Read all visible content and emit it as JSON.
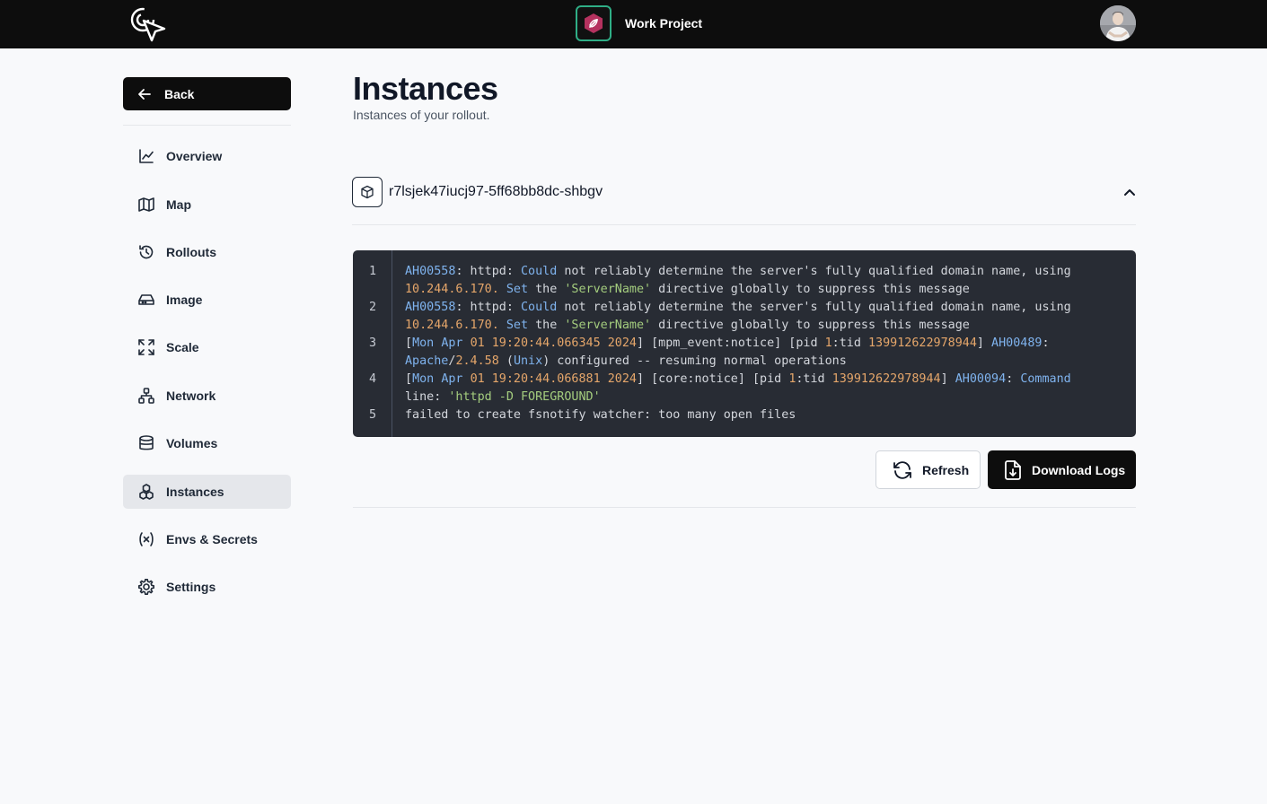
{
  "header": {
    "project_name": "Work Project"
  },
  "sidebar": {
    "back_label": "Back",
    "items": [
      {
        "label": "Overview",
        "icon": "chart-line-icon"
      },
      {
        "label": "Map",
        "icon": "map-icon"
      },
      {
        "label": "Rollouts",
        "icon": "history-icon"
      },
      {
        "label": "Image",
        "icon": "hard-drive-icon"
      },
      {
        "label": "Scale",
        "icon": "scale-expand-icon"
      },
      {
        "label": "Network",
        "icon": "network-icon"
      },
      {
        "label": "Volumes",
        "icon": "database-icon"
      },
      {
        "label": "Instances",
        "icon": "boxes-icon",
        "active": true
      },
      {
        "label": "Envs & Secrets",
        "icon": "variable-icon"
      },
      {
        "label": "Settings",
        "icon": "gear-icon"
      }
    ]
  },
  "main": {
    "title": "Instances",
    "subtitle": "Instances of your rollout.",
    "instance": {
      "name": "r7lsjek47iucj97-5ff68bb8dc-shbgv",
      "expanded": true
    },
    "logs": {
      "line_numbers": [
        "1",
        "2",
        "3",
        "4",
        "5"
      ],
      "lines": [
        "AH00558: httpd: Could not reliably determine the server's fully qualified domain name, using 10.244.6.170. Set the 'ServerName' directive globally to suppress this message",
        "AH00558: httpd: Could not reliably determine the server's fully qualified domain name, using 10.244.6.170. Set the 'ServerName' directive globally to suppress this message",
        "[Mon Apr 01 19:20:44.066345 2024] [mpm_event:notice] [pid 1:tid 139912622978944] AH00489: Apache/2.4.58 (Unix) configured -- resuming normal operations",
        "[Mon Apr 01 19:20:44.066881 2024] [core:notice] [pid 1:tid 139912622978944] AH00094: Command line: 'httpd -D FOREGROUND'",
        "failed to create fsnotify watcher: too many open files"
      ]
    },
    "buttons": {
      "refresh": "Refresh",
      "download": "Download Logs"
    }
  },
  "colors": {
    "topbar": "#0d0d0d",
    "project_badge_border": "#2fae86",
    "project_badge_fill": "#b5325f",
    "log_bg": "#282c34",
    "log_keyword": "#7fb3ee",
    "log_number": "#e5a66a",
    "log_string": "#a4cd7e"
  }
}
